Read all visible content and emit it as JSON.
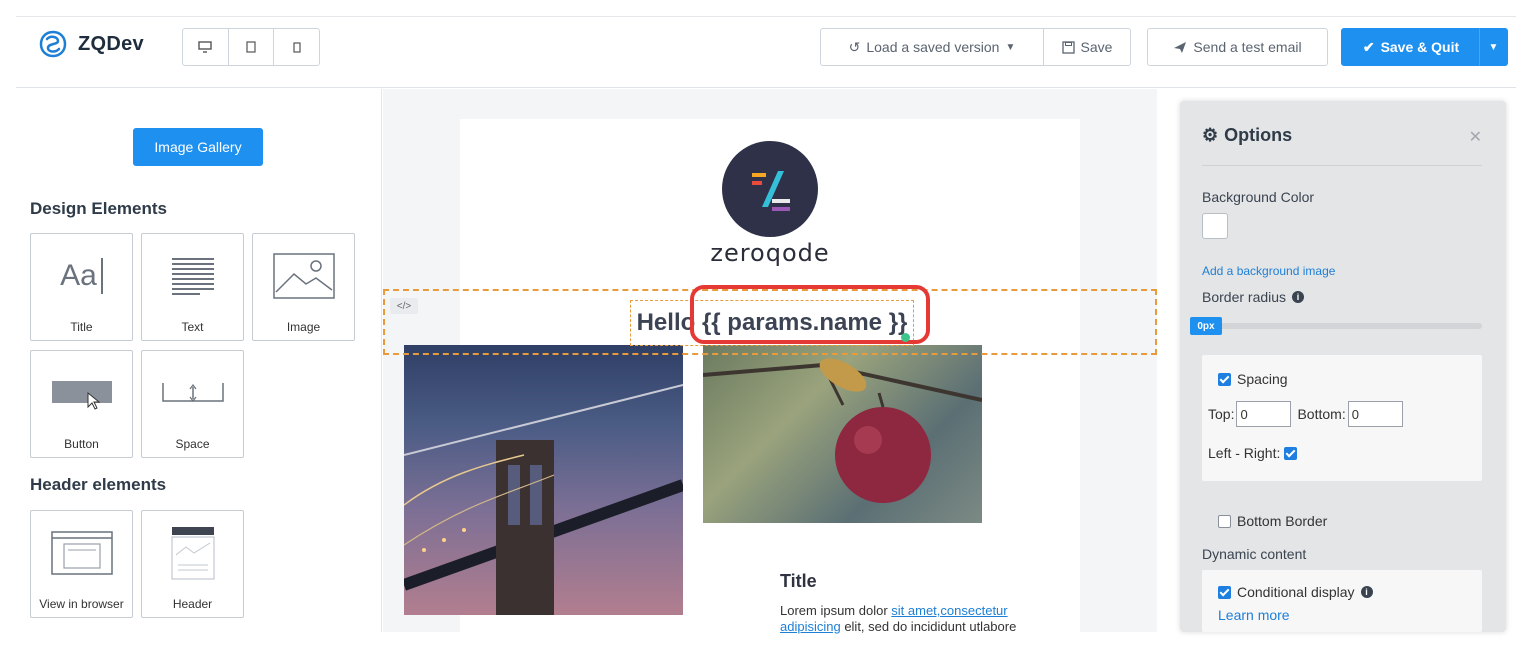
{
  "app": {
    "name": "ZQDev"
  },
  "toolbar": {
    "load_label": "Load a saved version",
    "save_label": "Save",
    "test_label": "Send a test email",
    "save_quit_label": "Save & Quit"
  },
  "left_panel": {
    "gallery_label": "Image Gallery",
    "design_title": "Design Elements",
    "design_items": [
      "Title",
      "Text",
      "Image",
      "Button",
      "Space"
    ],
    "title_icon_text": "Aa",
    "header_title": "Header elements",
    "header_items": [
      "View in browser",
      "Header"
    ]
  },
  "email": {
    "logo_text": "zeroqode",
    "greeting": "Hello {{ params.name }}",
    "card_title": "Title",
    "card_text_start": "Lorem ipsum dolor ",
    "card_link": "sit amet,consectetur adipisicing",
    "card_text_end": " elit, sed do incididunt utlabore"
  },
  "options": {
    "title": "Options",
    "bg_color_label": "Background Color",
    "bg_image_link": "Add a background image",
    "border_radius_label": "Border radius",
    "border_radius_value": "0px",
    "spacing_label": "Spacing",
    "top_label": "Top:",
    "top_value": "0",
    "bottom_label": "Bottom:",
    "bottom_value": "0",
    "left_right_label": "Left - Right:",
    "bottom_border_label": "Bottom Border",
    "dynamic_label": "Dynamic content",
    "conditional_label": "Conditional display",
    "learn_more": "Learn more"
  },
  "colors": {
    "accent": "#1e90f0",
    "highlight": "#e53935",
    "selection": "#e79b3c"
  }
}
